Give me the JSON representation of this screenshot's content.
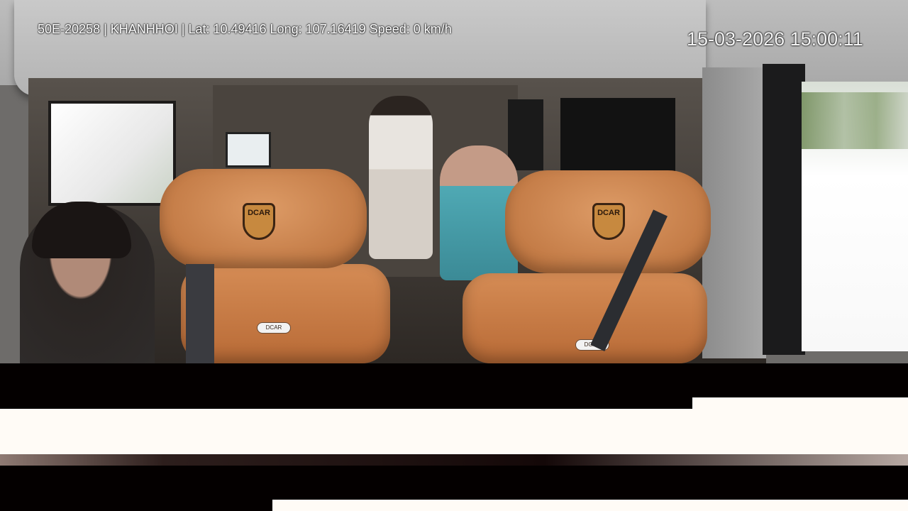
{
  "overlay": {
    "info_line": "50E-20258 | KHANHHOI | Lat: 10.49416 Long: 107.16419 Speed: 0 km/h",
    "timestamp": "15-03-2026 15:00:11"
  },
  "seats": {
    "headrest_logo": "DCAR",
    "seat_badge": "DCAR"
  },
  "colors": {
    "overlay_text": "#ffffff",
    "seat_leather": "#c97a44",
    "band_dark": "#040000",
    "band_light": "#fffbf6"
  }
}
